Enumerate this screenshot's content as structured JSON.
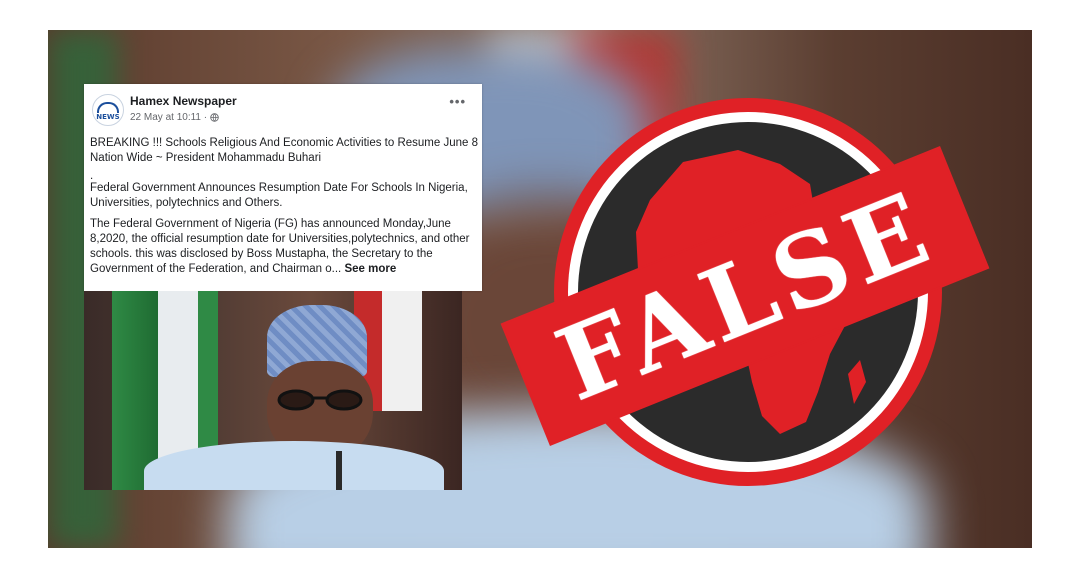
{
  "post": {
    "page_name": "Hamex Newspaper",
    "timestamp": "22 May at 10:11 ·",
    "avatar_text": "NEWS",
    "more_icon": "more-horizontal-icon",
    "headline": "BREAKING !!! Schools Religious And Economic Activities to Resume June 8 Nation Wide ~ President Mohammadu Buhari",
    "separator": ".",
    "subheadline": "Federal Government  Announces Resumption Date For Schools In Nigeria, Universities, polytechnics and Others.",
    "body": "The Federal Government of Nigeria (FG) has announced Monday,June 8,2020, the official resumption date for Universities,polytechnics, and other schools. this was disclosed by Boss Mustapha, the Secretary to the Government of the Federation, and Chairman o...",
    "see_more": "See more"
  },
  "stamp": {
    "label": "FALSE",
    "color": "#e02126"
  }
}
